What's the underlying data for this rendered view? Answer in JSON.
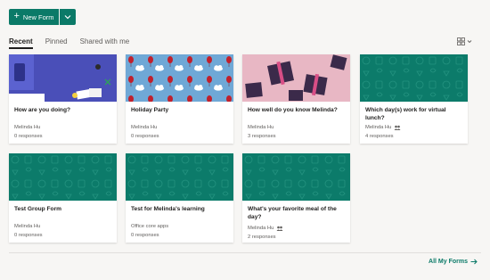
{
  "toolbar": {
    "new_form_label": "New Form"
  },
  "tabs": [
    {
      "label": "Recent",
      "active": true
    },
    {
      "label": "Pinned",
      "active": false
    },
    {
      "label": "Shared with me",
      "active": false
    }
  ],
  "forms": [
    {
      "title": "How are you doing?",
      "owner": "Melinda Hu",
      "responses": "0 responses",
      "cover": "blue-desk",
      "shared": false
    },
    {
      "title": "Holiday Party",
      "owner": "Melinda Hu",
      "responses": "0 responses",
      "cover": "balloons-clouds",
      "shared": false
    },
    {
      "title": "How well do you know Melinda?",
      "owner": "Melinda Hu",
      "responses": "3 responses",
      "cover": "pink-gifts",
      "shared": false
    },
    {
      "title": "Which day(s) work for virtual lunch?",
      "owner": "Melinda Hu",
      "responses": "4 responses",
      "cover": "teal-pattern",
      "shared": true
    },
    {
      "title": "Test Group Form",
      "owner": "Melinda Hu",
      "responses": "0 responses",
      "cover": "teal-pattern",
      "shared": false
    },
    {
      "title": "Test for Melinda's learning",
      "owner": "Office core apps",
      "responses": "0 responses",
      "cover": "teal-pattern",
      "shared": false
    },
    {
      "title": "What's your favorite meal of the day?",
      "owner": "Melinda Hu",
      "responses": "2 responses",
      "cover": "teal-pattern",
      "shared": true
    }
  ],
  "footer": {
    "all_forms_label": "All My Forms"
  },
  "colors": {
    "accent": "#0b7a68",
    "teal_cover": "#0c7b6a",
    "blue_cover": "#4a4fb8",
    "pink_cover": "#e8b7c4"
  },
  "icons": {
    "new": "plus-icon",
    "dropdown": "chevron-down-icon",
    "view": "grid-view-icon",
    "shared": "shared-icon",
    "arrow": "arrow-right-icon"
  }
}
